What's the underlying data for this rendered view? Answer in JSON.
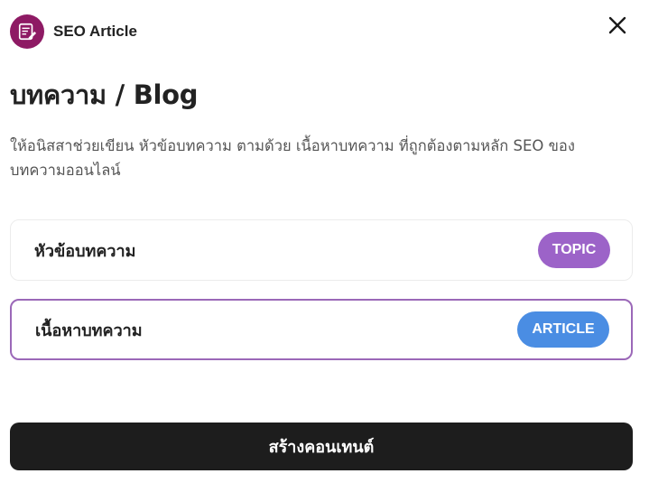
{
  "header": {
    "app_name": "SEO Article",
    "app_icon": "article-edit-icon",
    "close_icon": "close-icon"
  },
  "main": {
    "title": "บทความ / Blog",
    "description": "ให้อนิสสาช่วยเขียน หัวข้อบทความ ตามด้วย เนื้อหาบทความ ที่ถูกต้องตามหลัก SEO ของบทความออนไลน์"
  },
  "options": [
    {
      "label": "หัวข้อบทความ",
      "badge": "TOPIC",
      "badge_color": "#9c63c8",
      "selected": false
    },
    {
      "label": "เนื้อหาบทความ",
      "badge": "ARTICLE",
      "badge_color": "#4a8de3",
      "selected": true
    }
  ],
  "footer": {
    "create_label": "สร้างคอนเทนต์"
  },
  "colors": {
    "brand": "#8e1a64",
    "selected_border": "#9b68b8",
    "button_bg": "#1d1d1d"
  }
}
